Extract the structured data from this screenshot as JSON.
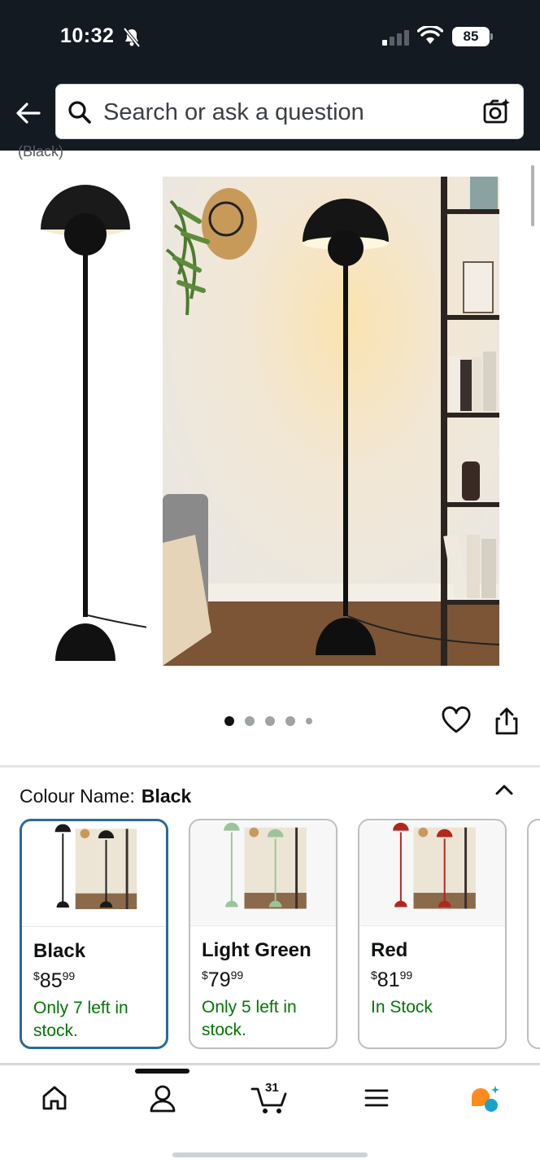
{
  "status_bar": {
    "time": "10:32",
    "battery": "85"
  },
  "search": {
    "placeholder": "Search or ask a question"
  },
  "product": {
    "truncated_title": "(Black)",
    "image_count": 5,
    "active_image": 1
  },
  "variation": {
    "label": "Colour Name:",
    "selected_value": "Black",
    "swatches": [
      {
        "name": "Black",
        "currency": "$",
        "dollars": "85",
        "cents": "99",
        "stock": "Only 7 left in stock.",
        "lamp_color": "#1a1a1a",
        "selected": true
      },
      {
        "name": "Light Green",
        "currency": "$",
        "dollars": "79",
        "cents": "99",
        "stock": "Only 5 left in stock.",
        "lamp_color": "#9cc49a",
        "selected": false
      },
      {
        "name": "Red",
        "currency": "$",
        "dollars": "81",
        "cents": "99",
        "stock": "In Stock",
        "lamp_color": "#b3261e",
        "selected": false
      }
    ]
  },
  "nav": {
    "cart_count": "31",
    "items": [
      "home-icon",
      "account-icon",
      "cart-icon",
      "menu-icon",
      "rufus-icon"
    ]
  },
  "colors": {
    "header_bg": "#131a22",
    "stock_green": "#007600",
    "selected_border": "#2b6a9a",
    "rufus_orange": "#ff8a1d",
    "rufus_teal": "#1aa3c8"
  }
}
